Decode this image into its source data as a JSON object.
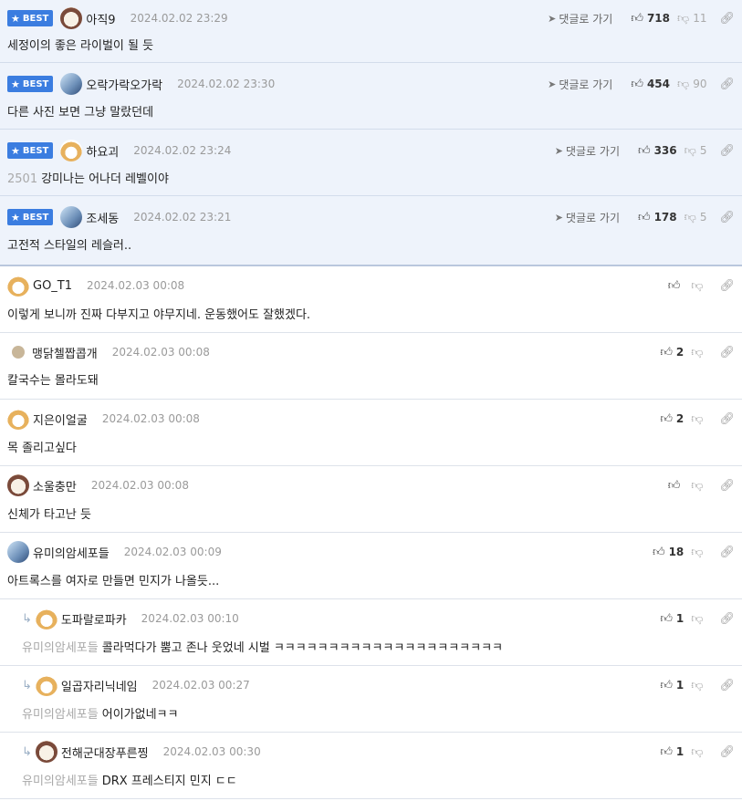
{
  "best_badge": "BEST",
  "goto_reply_label": "댓글로 가기",
  "comments": [
    {
      "best": true,
      "avatar": "face",
      "nick": "아직9",
      "date": "2024.02.02 23:29",
      "up": "718",
      "down": "11",
      "text": "세정이의 좋은 라이벌이 될 듯"
    },
    {
      "best": true,
      "avatar": "ice",
      "nick": "오락가락오가락",
      "date": "2024.02.02 23:30",
      "up": "454",
      "down": "90",
      "text": "다른 사진 보면 그냥 말랐던데"
    },
    {
      "best": true,
      "avatar": "dog",
      "nick": "하요괴",
      "date": "2024.02.02 23:24",
      "up": "336",
      "down": "5",
      "mention": "2501",
      "text": "강미나는 어나더 레벨이야"
    },
    {
      "best": true,
      "avatar": "ice",
      "nick": "조세동",
      "date": "2024.02.02 23:21",
      "up": "178",
      "down": "5",
      "text": "고전적 스타일의 레슬러.."
    },
    {
      "best": false,
      "avatar": "dog",
      "nick": "GO_T1",
      "date": "2024.02.03 00:08",
      "up": "",
      "down": "",
      "text": "이렇게 보니까 진짜 다부지고 야무지네. 운동했어도 잘했겠다."
    },
    {
      "best": false,
      "avatar": "dot",
      "nick": "맹닭첼짭콥개",
      "date": "2024.02.03 00:08",
      "up": "2",
      "down": "",
      "text": "칼국수는 몰라도돼"
    },
    {
      "best": false,
      "avatar": "dog",
      "nick": "지은이얼굴",
      "date": "2024.02.03 00:08",
      "up": "2",
      "down": "",
      "text": "목 졸리고싶다"
    },
    {
      "best": false,
      "avatar": "face",
      "nick": "소울충만",
      "date": "2024.02.03 00:08",
      "up": "",
      "down": "",
      "text": "신체가 타고난 듯"
    },
    {
      "best": false,
      "avatar": "ice",
      "nick": "유미의암세포들",
      "date": "2024.02.03 00:09",
      "up": "18",
      "down": "",
      "text": "아트록스를 여자로 만들면 민지가 나올듯..."
    },
    {
      "best": false,
      "reply": true,
      "avatar": "dog",
      "nick": "도파랄로파카",
      "date": "2024.02.03 00:10",
      "up": "1",
      "down": "",
      "mention": "유미의암세포들",
      "text": "콜라먹다가 뿜고 존나 웃었네 시벌 ㅋㅋㅋㅋㅋㅋㅋㅋㅋㅋㅋㅋㅋㅋㅋㅋㅋㅋㅋㅋㅋ"
    },
    {
      "best": false,
      "reply": true,
      "avatar": "dog",
      "nick": "일곱자리닉네임",
      "date": "2024.02.03 00:27",
      "up": "1",
      "down": "",
      "mention": "유미의암세포들",
      "text": "어이가없네ㅋㅋ"
    },
    {
      "best": false,
      "reply": true,
      "avatar": "face",
      "nick": "전해군대장푸른찡",
      "date": "2024.02.03 00:30",
      "up": "1",
      "down": "",
      "mention": "유미의암세포들",
      "text": "DRX 프레스티지 민지 ㄷㄷ"
    }
  ]
}
